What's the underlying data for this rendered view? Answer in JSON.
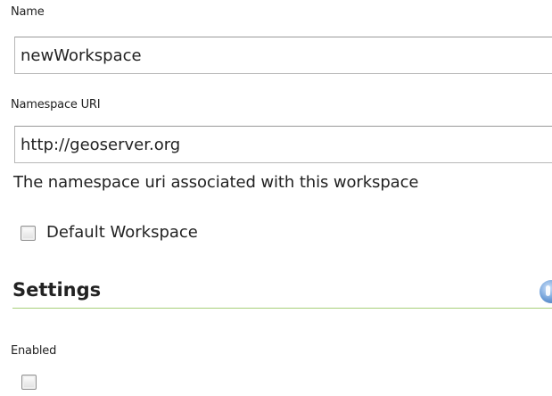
{
  "form": {
    "name_label": "Name",
    "name_value": "newWorkspace",
    "namespace_label": "Namespace URI",
    "namespace_value": "http://geoserver.org",
    "namespace_help": "The namespace uri associated with this workspace",
    "default_workspace_label": "Default Workspace",
    "default_workspace_checked": false
  },
  "settings": {
    "title": "Settings",
    "help_icon": "help-info-icon",
    "enabled_label": "Enabled",
    "enabled_checked": false,
    "rule_color": "#a8cf7a"
  }
}
